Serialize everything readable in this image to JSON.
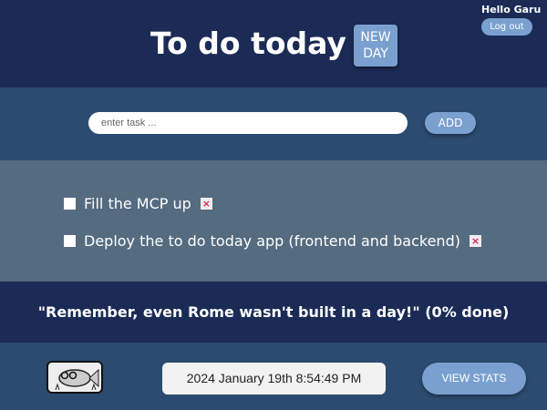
{
  "header": {
    "title": "To do today",
    "new_day": "NEW DAY",
    "greeting": "Hello Garu",
    "logout": "Log out"
  },
  "add": {
    "placeholder": "enter task ...",
    "button": "ADD"
  },
  "tasks": [
    {
      "label": "Fill the MCP up",
      "done": false,
      "delete": "×"
    },
    {
      "label": "Deploy the to do today app (frontend and backend)",
      "done": false,
      "delete": "×"
    }
  ],
  "quote": "\"Remember, even Rome wasn't built in a day!\" (0% done)",
  "footer": {
    "datetime": "2024 January 19th 8:54:49 PM",
    "stats": "VIEW STATS",
    "logo_icon": "fish-with-glasses-icon"
  },
  "colors": {
    "header": "#1b2b55",
    "section": "#2c4b70",
    "tasks": "#546b80",
    "accent": "#7aa0cf",
    "delete": "#e0205a"
  }
}
